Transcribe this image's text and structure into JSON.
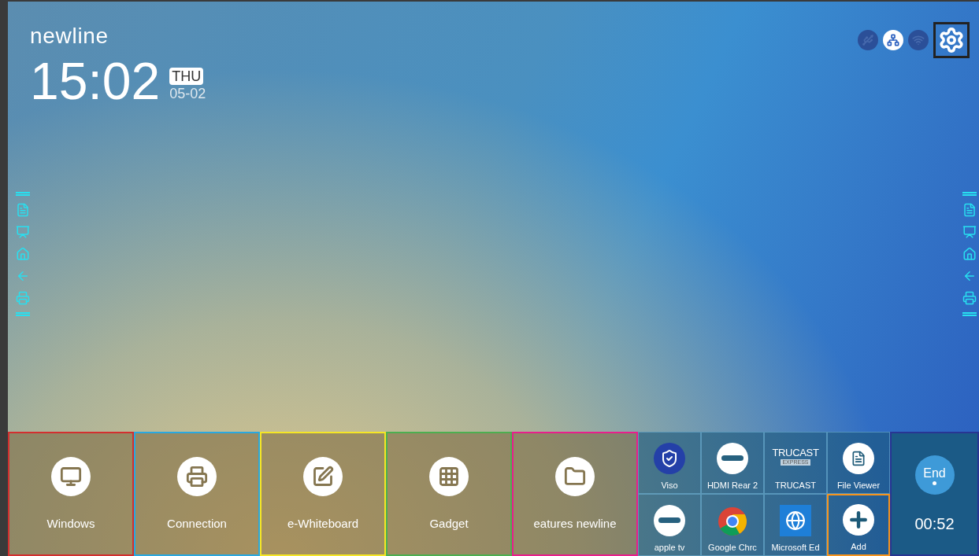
{
  "brand": "newline",
  "clock": {
    "time": "15:02",
    "weekday": "THU",
    "date": "05-02"
  },
  "status_icons": [
    {
      "kind": "usb",
      "on": false
    },
    {
      "kind": "ethernet",
      "on": true
    },
    {
      "kind": "wifi",
      "on": false
    },
    {
      "kind": "settings",
      "on": true,
      "color": "#222222"
    }
  ],
  "side_toolbar": [
    {
      "kind": "note"
    },
    {
      "kind": "whiteboard"
    },
    {
      "kind": "home"
    },
    {
      "kind": "back"
    },
    {
      "kind": "connection"
    }
  ],
  "tiles": [
    {
      "kind": "windows",
      "label": "Windows",
      "color": "#d32f2f"
    },
    {
      "kind": "connection",
      "label": "Connection",
      "color": "#29a8e0"
    },
    {
      "kind": "whiteboard",
      "label": "e-Whiteboard",
      "color": "#f5e625"
    },
    {
      "kind": "gadget",
      "label": "Gadget",
      "color": "#4caf50"
    },
    {
      "kind": "folder",
      "label": "eatures newline",
      "color": "#e91e8c"
    }
  ],
  "apps": [
    {
      "kind": "viso",
      "label": "Viso"
    },
    {
      "kind": "hdmi",
      "label": "HDMI Rear 2"
    },
    {
      "kind": "trucast",
      "label": "TRUCAST",
      "logo": "TRUCAST",
      "logo_sub": "EXPRESS"
    },
    {
      "kind": "fileviewer",
      "label": "File Viewer"
    },
    {
      "kind": "hdmi",
      "label": "apple tv"
    },
    {
      "kind": "chrome",
      "label": "Google Chrc"
    },
    {
      "kind": "edge",
      "label": "Microsoft Ed"
    },
    {
      "kind": "add",
      "label": "Add",
      "color": "#f7941d"
    }
  ],
  "end_panel": {
    "button": "End",
    "timer": "00:52",
    "color": "#283593"
  }
}
